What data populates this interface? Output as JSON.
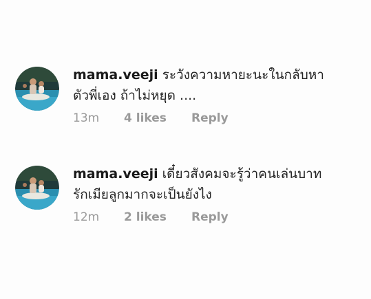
{
  "comments": [
    {
      "username": "mama.veeji",
      "text_line1": "ระวังความหายะนะในกลับหา",
      "text_line2": "ตัวพี่เอง ถ้าไม่หยุด ....",
      "time": "13m",
      "likes": "4 likes",
      "reply": "Reply",
      "avatar_icon": "profile-photo-pool"
    },
    {
      "username": "mama.veeji",
      "text_line1": "เดี๋ยวสังคมจะรู้ว่าคนเล่นบาท",
      "text_line2": "รักเมียลูกมากจะเป็นยังไง",
      "time": "12m",
      "likes": "2 likes",
      "reply": "Reply",
      "avatar_icon": "profile-photo-pool"
    }
  ],
  "colors": {
    "background": "#fdfdfd",
    "text": "#262626",
    "meta": "#9a9a9a"
  }
}
